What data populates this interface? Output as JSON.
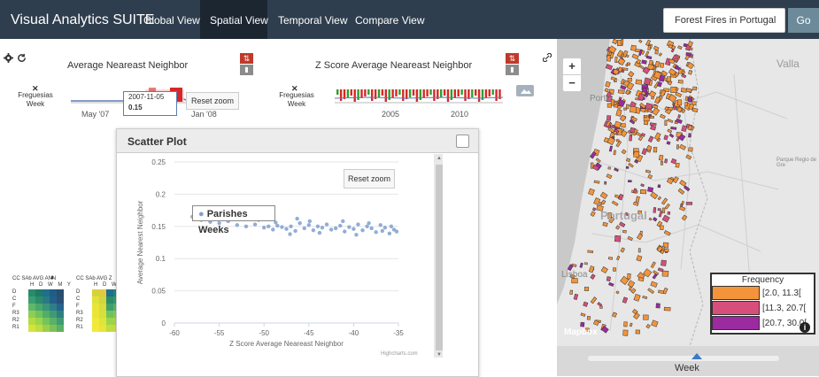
{
  "navbar": {
    "brand": "Visual Analytics SUITE",
    "tabs": [
      "Global View",
      "Spatial View",
      "Temporal View",
      "Compare View"
    ],
    "search_value": "Forest Fires in Portugal",
    "go_label": "Go"
  },
  "toolbar": {
    "left_title": "Average Neareast Neighbor",
    "right_title": "Z Score Average Neareast Neighbor",
    "left_axis_unit": "Freguesias\nWeek",
    "right_axis_unit": "Freguesias\nWeek",
    "left_ticks": [
      "May '07",
      "Jan '08"
    ],
    "right_ticks": [
      "2005",
      "2010"
    ],
    "tooltip_date": "2007-11-05",
    "tooltip_value": "0.15",
    "reset_zoom": "Reset zoom",
    "icons": [
      "gear-icon",
      "refresh-icon",
      "link-icon",
      "image-icon"
    ]
  },
  "heatmaps": [
    {
      "header": "CC SAb AVG ANN",
      "cols": "H D W M Y",
      "rows": [
        "D",
        "C",
        "F",
        "R3",
        "R2",
        "R1"
      ]
    },
    {
      "header": "CC SAb AVG Z",
      "cols": "H D W M",
      "rows": [
        "D",
        "C",
        "F",
        "R3",
        "R2",
        "R1"
      ]
    }
  ],
  "scatter_panel": {
    "title": "Scatter Plot",
    "reset_zoom": "Reset zoom",
    "credits": "Highcharts.com"
  },
  "chart_data": {
    "type": "scatter",
    "xlabel": "Z Score Average Neareast Neighbor",
    "ylabel": "Average Nearest Neighbor",
    "xlim": [
      -60,
      -35
    ],
    "ylim": [
      0,
      0.25
    ],
    "x_ticks": [
      "-60",
      "-55",
      "-50",
      "-45",
      "-40",
      "-35"
    ],
    "y_ticks": [
      "0",
      "0.05",
      "0.1",
      "0.15",
      "0.2",
      "0.25"
    ],
    "legend": "Parishes Weeks",
    "color": "#7f9fcf",
    "series": [
      {
        "name": "Parishes Weeks",
        "x": [
          -58.0,
          -57.0,
          -56.0,
          -55.0,
          -54.0,
          -53.0,
          -52.0,
          -51.0,
          -50.0,
          -49.5,
          -49.0,
          -48.5,
          -48.0,
          -47.5,
          -47.0,
          -46.5,
          -46.0,
          -45.5,
          -45.0,
          -44.5,
          -44.0,
          -43.5,
          -43.0,
          -42.5,
          -42.0,
          -41.5,
          -41.0,
          -40.5,
          -40.0,
          -39.5,
          -39.0,
          -38.5,
          -38.0,
          -37.5,
          -37.0,
          -36.5,
          -36.0,
          -35.5,
          -35.2,
          -48.7,
          -46.3,
          -41.2,
          -43.8,
          -47.1,
          -38.3,
          -36.8,
          -50.6,
          -44.9,
          -39.7,
          -35.8
        ],
        "y": [
          0.165,
          0.16,
          0.157,
          0.155,
          0.158,
          0.152,
          0.15,
          0.153,
          0.148,
          0.15,
          0.145,
          0.151,
          0.149,
          0.146,
          0.15,
          0.143,
          0.155,
          0.147,
          0.152,
          0.144,
          0.15,
          0.148,
          0.153,
          0.145,
          0.147,
          0.151,
          0.142,
          0.149,
          0.146,
          0.153,
          0.144,
          0.15,
          0.147,
          0.141,
          0.152,
          0.148,
          0.139,
          0.145,
          0.142,
          0.156,
          0.162,
          0.158,
          0.14,
          0.138,
          0.155,
          0.143,
          0.16,
          0.158,
          0.137,
          0.15
        ]
      }
    ]
  },
  "map": {
    "labels": [
      "Porto",
      "Portugal",
      "Lisboa",
      "Valla",
      "Parque Regio de Gre",
      "Mapbox"
    ],
    "zoom_in": "+",
    "zoom_out": "−",
    "legend": {
      "title": "Frequency",
      "items": [
        {
          "label": "[2.0, 11.3[",
          "color": "#f4943a"
        },
        {
          "label": "[11.3, 20.7[",
          "color": "#d64f7a"
        },
        {
          "label": "[20.7, 30.0[",
          "color": "#9c2aa0"
        }
      ]
    },
    "slider_label": "Week",
    "info_icon": "info-icon"
  }
}
